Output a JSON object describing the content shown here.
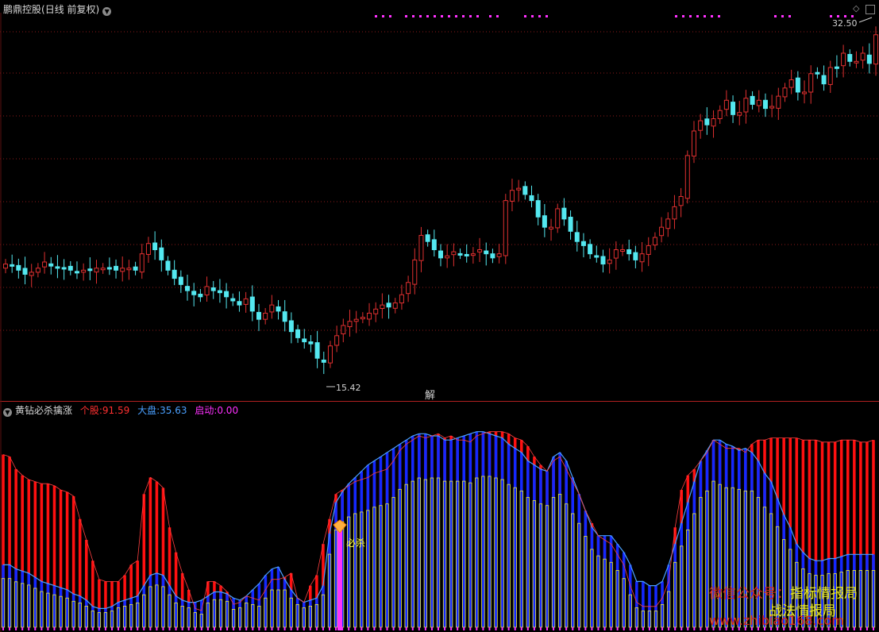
{
  "header": {
    "title": "鹏鼎控股",
    "period": "(日线 前复权)",
    "dropdown_icon": "chevron-down-icon"
  },
  "indicator": {
    "name": "黄钻必杀擒涨",
    "items": [
      {
        "label": "个股:",
        "value": "91.59",
        "color": "#ff3030"
      },
      {
        "label": "大盘:",
        "value": "35.63",
        "color": "#4aa0ff"
      },
      {
        "label": "启动:",
        "value": "0.00",
        "color": "#ff30ff"
      }
    ],
    "signal_label": "必杀",
    "marker_label": "解"
  },
  "price_labels": {
    "high": "32.50",
    "low": "15.42"
  },
  "corner_icons": [
    "diamond-icon",
    "window-box-icon"
  ],
  "watermark": {
    "line1": "微信公众号：",
    "line1b": "指标情报局",
    "line2": "战法情报局",
    "line3": "www.zhibiao168.com"
  },
  "colors": {
    "up": "#e03030",
    "down": "#54e8f0",
    "grid": "#8b1a1a",
    "individual": "#ff1010",
    "market": "#1428ff",
    "market_line": "#4aa0ff",
    "yellow_bars": "#f0f040",
    "start_signal": "#ff30ff"
  },
  "chart_data": [
    {
      "type": "candlestick",
      "title": "鹏鼎控股",
      "y_low": 15.42,
      "y_high": 32.5,
      "close": [
        21.3,
        21.2,
        21.0,
        20.8,
        20.9,
        21.1,
        21.4,
        21.2,
        21.1,
        21.1,
        21.0,
        20.9,
        21.0,
        21.0,
        21.1,
        21.1,
        21.1,
        21.0,
        21.1,
        21.1,
        21.0,
        21.8,
        22.3,
        22.0,
        21.5,
        21.0,
        20.6,
        20.3,
        20.0,
        19.8,
        19.7,
        20.2,
        20.0,
        19.9,
        19.7,
        19.5,
        19.3,
        19.6,
        19.0,
        18.6,
        18.9,
        19.3,
        19.0,
        18.5,
        18.0,
        17.7,
        17.5,
        17.4,
        16.7,
        16.5,
        17.3,
        17.8,
        18.3,
        18.5,
        18.6,
        18.7,
        18.9,
        19.1,
        19.3,
        19.2,
        19.4,
        19.8,
        20.4,
        21.5,
        22.7,
        22.4,
        22.0,
        21.6,
        21.7,
        21.9,
        21.8,
        21.7,
        21.8,
        22.0,
        21.8,
        21.6,
        21.8,
        24.4,
        24.9,
        25.0,
        24.7,
        24.4,
        23.6,
        23.1,
        23.1,
        24.0,
        23.5,
        22.9,
        22.4,
        22.2,
        21.8,
        21.7,
        21.3,
        21.5,
        22.0,
        22.0,
        21.8,
        21.5,
        21.8,
        22.2,
        22.6,
        23.1,
        23.5,
        24.1,
        24.6,
        26.6,
        27.8,
        28.3,
        28.1,
        28.4,
        28.8,
        29.3,
        28.6,
        28.7,
        29.4,
        29.1,
        29.3,
        28.9,
        29.0,
        29.5,
        29.9,
        30.3,
        29.7,
        29.7,
        30.6,
        30.6,
        30.1,
        30.9,
        30.9,
        31.6,
        31.2,
        31.2,
        31.6,
        31.1,
        32.5
      ]
    },
    {
      "type": "bar",
      "title": "黄钻必杀擒涨",
      "y_range": [
        0,
        100
      ],
      "series": [
        {
          "name": "个股",
          "values": [
            83,
            82,
            76,
            73,
            71,
            70,
            69,
            69,
            68,
            66,
            65,
            63,
            52,
            42,
            32,
            23,
            22,
            22,
            22,
            25,
            30,
            32,
            64,
            72,
            70,
            67,
            48,
            36,
            26,
            18,
            9,
            8,
            22,
            22,
            20,
            17,
            11,
            12,
            15,
            14,
            13,
            18,
            23,
            23,
            24,
            26,
            14,
            12,
            20,
            25,
            40,
            52,
            64,
            66,
            68,
            70,
            71,
            72,
            74,
            75,
            76,
            80,
            85,
            88,
            90,
            92,
            91,
            92,
            93,
            91,
            92,
            90,
            90,
            89,
            92,
            93,
            94,
            94,
            94,
            93,
            91,
            90,
            87,
            82,
            78,
            75,
            80,
            82,
            76,
            70,
            64,
            56,
            50,
            44,
            42,
            40,
            35,
            30,
            20,
            12,
            10,
            10,
            10,
            14,
            22,
            48,
            66,
            73,
            76,
            80,
            84,
            90,
            88,
            86,
            86,
            86,
            84,
            88,
            90,
            90,
            91,
            91,
            91,
            91,
            91,
            90,
            90,
            90,
            89,
            89,
            89,
            90,
            90,
            90,
            89,
            89,
            90
          ]
        },
        {
          "name": "大盘",
          "values": [
            30,
            30,
            28,
            27,
            26,
            24,
            22,
            21,
            20,
            19,
            18,
            16,
            15,
            13,
            10,
            9,
            9,
            10,
            12,
            13,
            14,
            15,
            20,
            25,
            26,
            25,
            20,
            15,
            13,
            12,
            12,
            13,
            15,
            17,
            17,
            16,
            14,
            13,
            15,
            18,
            21,
            25,
            28,
            29,
            23,
            18,
            14,
            12,
            13,
            14,
            20,
            45,
            60,
            65,
            69,
            72,
            75,
            78,
            80,
            82,
            84,
            86,
            88,
            90,
            92,
            93,
            93,
            92,
            92,
            90,
            90,
            91,
            92,
            93,
            94,
            94,
            93,
            92,
            91,
            88,
            86,
            84,
            80,
            78,
            76,
            75,
            82,
            84,
            80,
            72,
            64,
            56,
            48,
            44,
            44,
            44,
            40,
            36,
            30,
            22,
            22,
            20,
            20,
            22,
            30,
            40,
            50,
            60,
            70,
            80,
            85,
            90,
            90,
            88,
            87,
            85,
            86,
            84,
            80,
            74,
            70,
            62,
            54,
            48,
            40,
            36,
            33,
            32,
            32,
            33,
            33,
            34,
            35,
            35,
            35,
            35,
            35,
            35,
            35,
            35,
            35
          ]
        },
        {
          "name": "启动",
          "values": [
            0
          ]
        }
      ]
    }
  ]
}
